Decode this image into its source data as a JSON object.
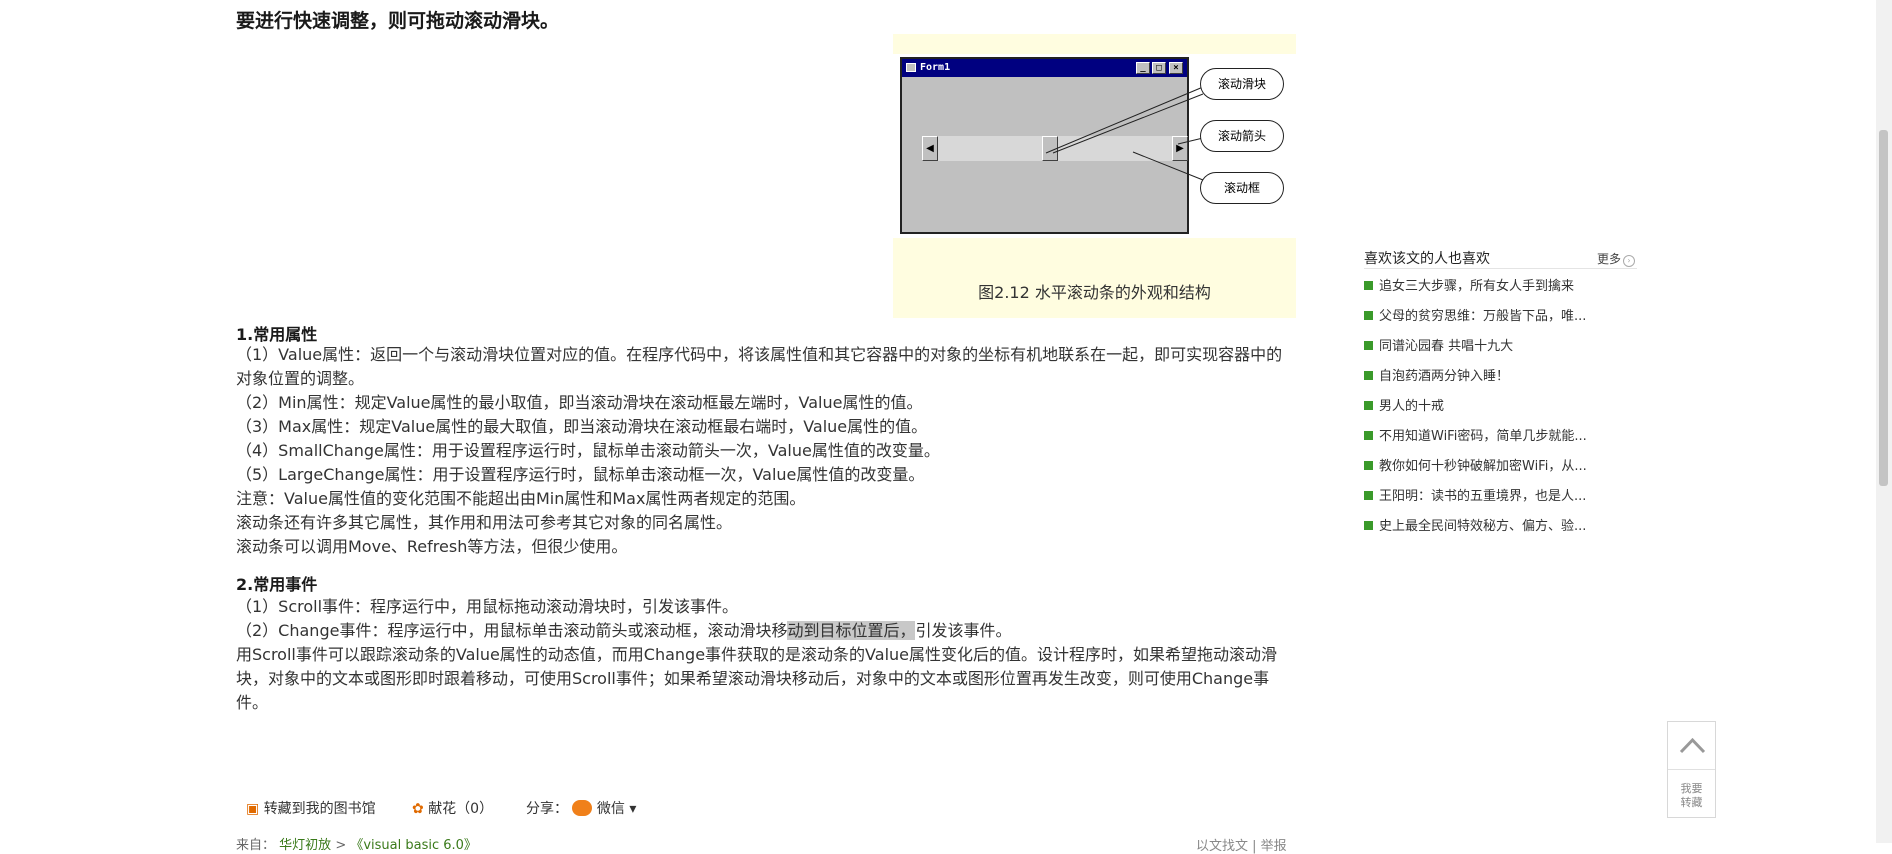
{
  "article": {
    "top_line": "要进行快速调整，则可拖动滚动滑块。",
    "figure": {
      "form_title": "Form1",
      "callouts": [
        "滚动滑块",
        "滚动箭头",
        "滚动框"
      ],
      "caption": "图2.12 水平滚动条的外观和结构"
    },
    "section1": {
      "title": "1.常用属性",
      "lines": [
        "（1）Value属性：返回一个与滚动滑块位置对应的值。在程序代码中，将该属性值和其它容器中的对象的坐标有机地联系在一起，即可实现容器中的对象位置的调整。",
        "（2）Min属性：规定Value属性的最小取值，即当滚动滑块在滚动框最左端时，Value属性的值。",
        "（3）Max属性：规定Value属性的最大取值，即当滚动滑块在滚动框最右端时，Value属性的值。",
        "（4）SmallChange属性：用于设置程序运行时，鼠标单击滚动箭头一次，Value属性值的改变量。",
        "（5）LargeChange属性：用于设置程序运行时，鼠标单击滚动框一次，Value属性值的改变量。",
        "注意：Value属性值的变化范围不能超出由Min属性和Max属性两者规定的范围。",
        "滚动条还有许多其它属性，其作用和用法可参考其它对象的同名属性。",
        "滚动条可以调用Move、Refresh等方法，但很少使用。"
      ]
    },
    "section2": {
      "title": "2.常用事件",
      "line1": "（1）Scroll事件：程序运行中，用鼠标拖动滚动滑块时，引发该事件。",
      "line2_a": "（2）Change事件：程序运行中，用鼠标单击滚动箭头或滚动框，滚动滑块移",
      "line2_hl": "动到目标位置后，",
      "line2_b": "引发该事件。",
      "para": "用Scroll事件可以跟踪滚动条的Value属性的动态值，而用Change事件获取的是滚动条的Value属性变化后的值。设计程序时，如果希望拖动滚动滑块，对象中的文本或图形即时跟着移动，可使用Scroll事件；如果希望滚动滑块移动后，对象中的文本或图形位置再发生改变，则可使用Change事件。"
    }
  },
  "toolbar": {
    "save_label": "转藏到我的图书馆",
    "flower_label": "献花（0）",
    "share_label": "分享：",
    "wechat_label": "微信"
  },
  "breadcrumb": {
    "prefix": "来自：",
    "source": "华灯初放",
    "sep": " > ",
    "category": "《visual basic 6.0》"
  },
  "bottom_right": "以文找文 | 举报",
  "sidebar": {
    "heading": "喜欢该文的人也喜欢",
    "more": "更多",
    "items": [
      "追女三大步骤，所有女人手到擒来",
      "父母的贫穷思维：万般皆下品，唯...",
      "同谱沁园春 共唱十九大",
      "自泡药酒两分钟入睡！",
      "男人的十戒",
      "不用知道WiFi密码，简单几步就能...",
      "教你如何十秒钟破解加密WiFi，从...",
      "王阳明：读书的五重境界，也是人...",
      "史上最全民间特效秘方、偏方、验..."
    ]
  },
  "back_to_top": {
    "line1": "我要",
    "line2": "转藏"
  },
  "colors": {
    "figure_bg": "#fffde0",
    "bullet_green": "#3a9a2a",
    "link_green": "#3a7a1a",
    "vb_title": "#000080"
  }
}
